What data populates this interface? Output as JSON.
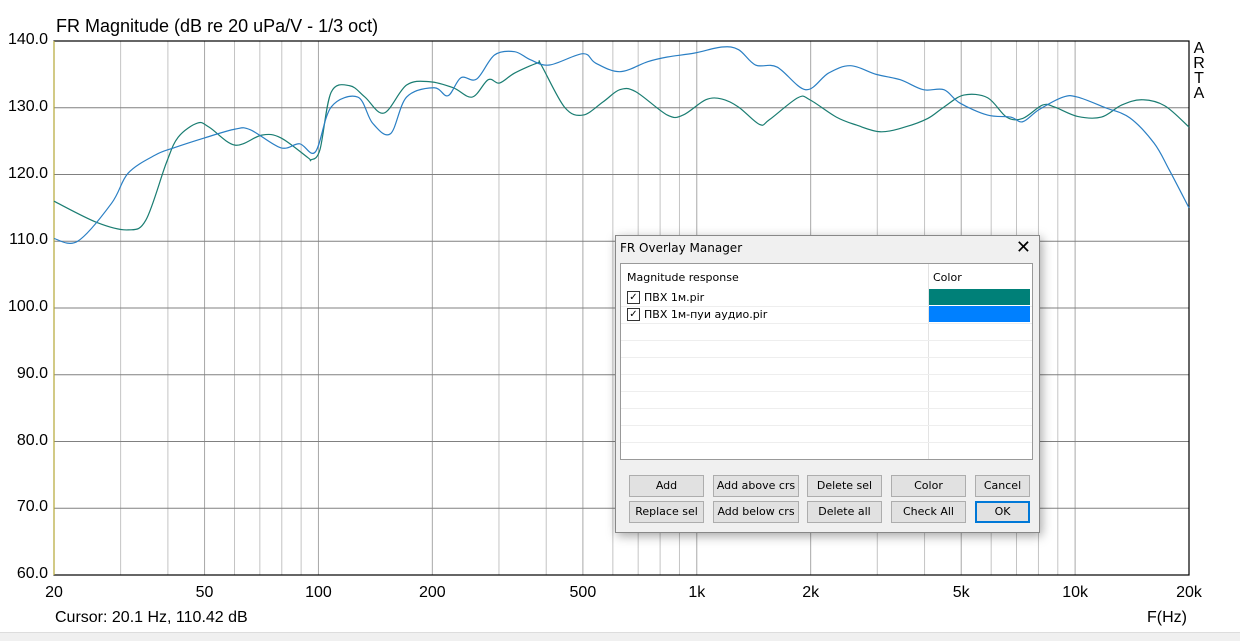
{
  "chart_data": {
    "type": "line",
    "title": "FR Magnitude (dB re 20 uPa/V - 1/3 oct)",
    "xlabel": "F(Hz)",
    "ylabel": "",
    "x_scale": "log",
    "xlim": [
      20,
      20000
    ],
    "ylim": [
      60,
      140
    ],
    "grid": true,
    "x_ticks": [
      20,
      50,
      100,
      200,
      500,
      1000,
      2000,
      5000,
      10000,
      20000
    ],
    "x_tick_labels": [
      "20",
      "50",
      "100",
      "200",
      "500",
      "1k",
      "2k",
      "5k",
      "10k",
      "20k"
    ],
    "y_ticks": [
      60,
      70,
      80,
      90,
      100,
      110,
      120,
      130,
      140
    ],
    "y_tick_labels": [
      "60.0",
      "70.0",
      "80.0",
      "90.0",
      "100.0",
      "110.0",
      "120.0",
      "130.0",
      "140.0"
    ],
    "series": [
      {
        "name": "ПВХ 1м.pir",
        "color": "#1a7d72",
        "x": [
          20,
          26,
          31.4,
          35,
          39.6,
          42.6,
          47.9,
          51.4,
          60.2,
          70.8,
          79.5,
          93.9,
          95.5,
          100.9,
          108,
          121,
          132.7,
          149,
          171,
          197,
          227,
          255,
          281,
          301,
          330,
          379,
          388,
          447,
          500,
          566,
          626,
          690,
          836,
          920,
          1057,
          1166,
          1290,
          1465,
          1555,
          1850,
          1989,
          2339,
          2645,
          3055,
          3545,
          4080,
          4500,
          5080,
          5870,
          6590,
          7270,
          8200,
          8830,
          10150,
          11740,
          13270,
          15000,
          17250,
          20000
        ],
        "y": [
          116,
          112.8,
          111.7,
          113.2,
          121.7,
          125.6,
          127.7,
          127.1,
          124.4,
          125.9,
          125.5,
          122.5,
          122.2,
          123.7,
          132.3,
          133.3,
          131.6,
          129.2,
          133.4,
          133.9,
          133,
          131.6,
          134.2,
          133.7,
          135.2,
          136.7,
          136.4,
          130.1,
          128.9,
          130.9,
          132.7,
          132.4,
          128.9,
          128.9,
          131.2,
          131.3,
          130.1,
          127.5,
          128.2,
          131.5,
          131.2,
          128.6,
          127.4,
          126.4,
          127.1,
          128.4,
          130.1,
          131.9,
          131.5,
          128.6,
          128.4,
          130.4,
          130.1,
          128.7,
          128.6,
          130.4,
          131.2,
          130.3,
          127.1
        ]
      },
      {
        "name": "ПВХ 1м-пуи аудио.pir",
        "color": "#2a7fc4",
        "x": [
          20,
          23.1,
          28.4,
          31.4,
          37,
          41.5,
          50.1,
          60.2,
          66.1,
          79.5,
          89.2,
          98.2,
          108,
          127,
          139,
          155,
          171,
          202,
          220,
          238,
          262,
          292,
          330,
          363,
          408,
          500,
          540,
          626,
          742,
          836,
          988,
          1166,
          1290,
          1430,
          1630,
          1940,
          2230,
          2550,
          2980,
          3450,
          3970,
          4500,
          4960,
          5870,
          6750,
          7270,
          8020,
          9300,
          10150,
          12030,
          13940,
          16170,
          17730,
          20000
        ],
        "y": [
          110.4,
          110,
          115.7,
          120.2,
          122.9,
          124,
          125.5,
          126.8,
          126.7,
          124,
          124.6,
          123.4,
          130.1,
          131.6,
          127.7,
          126.1,
          131.6,
          133,
          131.8,
          134.5,
          134.3,
          137.9,
          138.4,
          137.2,
          136.4,
          138.1,
          136.7,
          135.4,
          136.9,
          137.6,
          138.2,
          139.1,
          138.7,
          136.4,
          136.1,
          132.7,
          135.2,
          136.3,
          135,
          134.2,
          132.7,
          132.7,
          130.7,
          128.9,
          128.6,
          127.9,
          129.7,
          131.6,
          131.6,
          130,
          128.5,
          124.7,
          120.7,
          115
        ]
      }
    ]
  },
  "app_mark": [
    "A",
    "R",
    "T",
    "A"
  ],
  "cursor_readout": "Cursor: 20.1 Hz, 110.42 dB",
  "dialog": {
    "title": "FR Overlay Manager",
    "close_glyph": "✕",
    "col_name": "Magnitude response",
    "col_color": "Color",
    "items": [
      {
        "name": "ПВХ 1м.pir",
        "checked": true,
        "color": "#008078"
      },
      {
        "name": "ПВХ 1м-пуи аудио.pir",
        "checked": true,
        "color": "#0080ff"
      }
    ],
    "check_glyph": "✓",
    "buttons": {
      "add": "Add",
      "add_above": "Add above crs",
      "delete_sel": "Delete sel",
      "color": "Color",
      "cancel": "Cancel",
      "replace_sel": "Replace sel",
      "add_below": "Add below crs",
      "delete_all": "Delete all",
      "check_all": "Check All",
      "ok": "OK"
    }
  }
}
